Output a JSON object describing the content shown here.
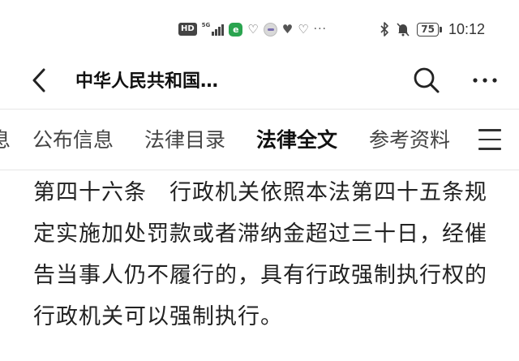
{
  "status_bar": {
    "hd_label": "HD",
    "network_label": "5G",
    "app_icon_letter": "e",
    "more_dots": "···",
    "battery_level": "75",
    "time": "10:12"
  },
  "header": {
    "title": "中华人民共和国…"
  },
  "tabs": [
    {
      "label": "息"
    },
    {
      "label": "公布信息"
    },
    {
      "label": "法律目录"
    },
    {
      "label": "法律全文",
      "active": true
    },
    {
      "label": "参考资料"
    }
  ],
  "article": {
    "text": "第四十六条　行政机关依照本法第四十五条规定实施加处罚款或者滞纳金超过三十日，经催告当事人仍不履行的，具有行政强制执行权的行政机关可以强制执行。"
  },
  "icons": {
    "back": "back-arrow-icon",
    "search": "search-icon",
    "more": "more-icon",
    "menu": "menu-icon"
  }
}
